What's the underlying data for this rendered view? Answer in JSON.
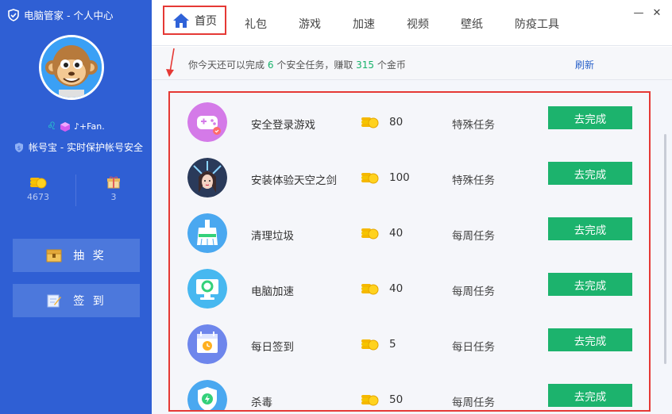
{
  "window": {
    "title": "电脑管家 - 个人中心"
  },
  "sidebar": {
    "username": "♪+Fan.",
    "security_text": "帐号宝 - 实时保护帐号安全",
    "coins": "4673",
    "gifts": "3",
    "lottery_label": "抽 奖",
    "signin_label": "签 到"
  },
  "nav": {
    "tabs": [
      "首页",
      "礼包",
      "游戏",
      "加速",
      "视频",
      "壁纸",
      "防疫工具"
    ]
  },
  "info": {
    "prefix": "你今天还可以完成",
    "task_count": "6",
    "middle": "个安全任务，赚取",
    "coin_count": "315",
    "suffix": "个金币",
    "refresh_label": "刷新"
  },
  "tasks": [
    {
      "name": "安全登录游戏",
      "reward": "80",
      "type": "特殊任务",
      "button": "去完成",
      "icon": "gamepad-icon"
    },
    {
      "name": "安装体验天空之剑",
      "reward": "100",
      "type": "特殊任务",
      "button": "去完成",
      "icon": "game-character-icon"
    },
    {
      "name": "清理垃圾",
      "reward": "40",
      "type": "每周任务",
      "button": "去完成",
      "icon": "broom-icon"
    },
    {
      "name": "电脑加速",
      "reward": "40",
      "type": "每周任务",
      "button": "去完成",
      "icon": "monitor-speed-icon"
    },
    {
      "name": "每日签到",
      "reward": "5",
      "type": "每日任务",
      "button": "去完成",
      "icon": "calendar-clock-icon"
    },
    {
      "name": "杀毒",
      "reward": "50",
      "type": "每周任务",
      "button": "去完成",
      "icon": "shield-bolt-icon"
    }
  ],
  "colors": {
    "sidebar": "#2f5fd4",
    "accent_green": "#1cb36d",
    "highlight_red": "#e53935"
  }
}
